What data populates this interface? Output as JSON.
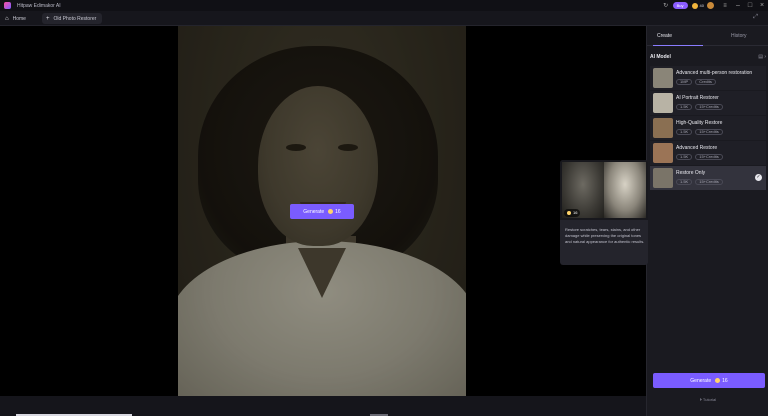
{
  "window": {
    "title": "Hitpaw Edimakor AI",
    "buy_label": "Buy",
    "credits": "40"
  },
  "tabs": {
    "home_label": "Home",
    "active_label": "Old Photo Restorer"
  },
  "canvas": {
    "generate_label": "Generate",
    "generate_cost": "16"
  },
  "panel": {
    "tabs": [
      "Create",
      "History"
    ],
    "model_header": "AI Model",
    "model_header_right": "Filter",
    "models": [
      {
        "name": "Advanced multi-person restoration",
        "tags": [
          "1MP",
          "Credits"
        ],
        "thumb_color": "#8a8578",
        "selected": false
      },
      {
        "name": "AI Portrait Restorer",
        "tags": [
          "1.5K",
          "15+Credits"
        ],
        "thumb_color": "#b8b3a5",
        "selected": false
      },
      {
        "name": "High-Quality Restore",
        "tags": [
          "1.5K",
          "15+Credits"
        ],
        "thumb_color": "#8a6f52",
        "selected": false
      },
      {
        "name": "Advanced Restore",
        "tags": [
          "1.5K",
          "15+Credits"
        ],
        "thumb_color": "#9b7456",
        "selected": false
      },
      {
        "name": "Restore Only",
        "tags": [
          "1.5K",
          "15+Credits"
        ],
        "thumb_color": "#7a7468",
        "selected": true
      }
    ],
    "generate_label": "Generate",
    "generate_cost": "16",
    "tutorial_label": "Tutorial"
  },
  "popup": {
    "cost": "16",
    "description": "Restore scratches, tears, stains, and other damage while preserving the original tones and natural appearance for authentic results."
  }
}
